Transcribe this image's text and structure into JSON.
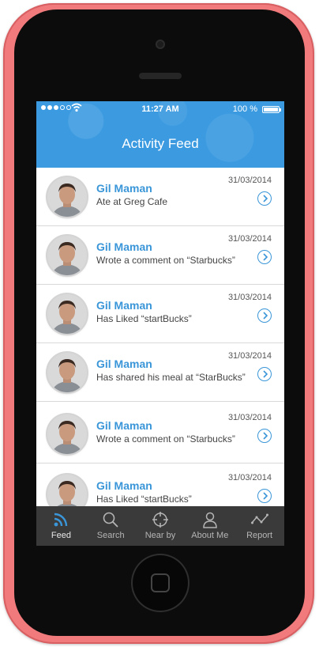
{
  "status_bar": {
    "time": "11:27 AM",
    "battery": "100 %"
  },
  "header": {
    "title": "Activity Feed"
  },
  "feed": {
    "items": [
      {
        "name": "Gil Maman",
        "text": "Ate at Greg Cafe",
        "date": "31/03/2014"
      },
      {
        "name": "Gil Maman",
        "text": "Wrote a comment on “Starbucks”",
        "date": "31/03/2014"
      },
      {
        "name": "Gil Maman",
        "text": "Has Liked “startBucks”",
        "date": "31/03/2014"
      },
      {
        "name": "Gil Maman",
        "text": "Has shared his meal at “StarBucks”",
        "date": "31/03/2014"
      },
      {
        "name": "Gil Maman",
        "text": "Wrote a comment on “Starbucks”",
        "date": "31/03/2014"
      },
      {
        "name": "Gil Maman",
        "text": "Has Liked “startBucks”",
        "date": "31/03/2014"
      }
    ]
  },
  "tab_bar": {
    "tabs": [
      {
        "label": "Feed",
        "icon": "rss-icon",
        "active": true
      },
      {
        "label": "Search",
        "icon": "search-icon"
      },
      {
        "label": "Near by",
        "icon": "crosshair-icon"
      },
      {
        "label": "About Me",
        "icon": "user-icon"
      },
      {
        "label": "Report",
        "icon": "line-chart-icon"
      }
    ]
  },
  "colors": {
    "accent": "#3a96d8",
    "header": "#3b9ae0",
    "tab_bar": "#3a3a3a",
    "case": "#f07a7c"
  }
}
